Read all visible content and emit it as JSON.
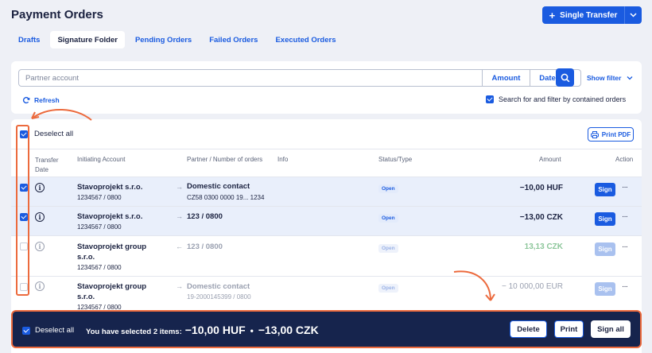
{
  "page_title": "Payment Orders",
  "single_transfer": {
    "plus": "+",
    "label": "Single Transfer",
    "caret": "⌄"
  },
  "tabs": [
    {
      "label": "Drafts"
    },
    {
      "label": "Signature Folder"
    },
    {
      "label": "Pending Orders"
    },
    {
      "label": "Failed Orders"
    },
    {
      "label": "Executed Orders"
    }
  ],
  "filter": {
    "search_placeholder": "Partner account",
    "amount_label": "Amount",
    "date_label": "Date",
    "show_filter": "Show filter",
    "refresh": "Refresh",
    "contained_label": "Search for and filter by contained orders"
  },
  "table": {
    "deselect_all": "Deselect all",
    "print_pdf": "Print PDF",
    "columns": {
      "transfer_date": "Transfer Date",
      "initiating_account": "Initiating Account",
      "partner": "Partner / Number of orders",
      "info": "Info",
      "status": "Status/Type",
      "amount": "Amount",
      "action": "Action"
    },
    "rows": [
      {
        "account": "Stavoprojekt s.r.o.",
        "account_number": "1234567 / 0800",
        "partner": "Domestic contact",
        "partner_number": "CZ58 0300 0000 19... 1234",
        "status": "Open",
        "amount": "−10,00 HUF",
        "sign": "Sign",
        "more": "···"
      },
      {
        "account": "Stavoprojekt s.r.o.",
        "account_number": "1234567 / 0800",
        "partner": "123 / 0800",
        "partner_number": "",
        "status": "Open",
        "amount": "−13,00 CZK",
        "sign": "Sign",
        "more": "···"
      },
      {
        "account": "Stavoprojekt group s.r.o.",
        "account_number": "1234567 / 0800",
        "partner": "123 / 0800",
        "partner_number": "",
        "status": "Open",
        "amount": "13,13 CZK",
        "sign": "Sign",
        "more": "···"
      },
      {
        "account": "Stavoprojekt group s.r.o.",
        "account_number": "1234567 / 0800",
        "partner": "Domestic contact",
        "partner_number": "19-2000145399 / 0800",
        "status": "Open",
        "amount": "− 10 000,00 EUR",
        "sign": "Sign",
        "more": "···"
      }
    ]
  },
  "bottom_bar": {
    "deselect_all": "Deselect all",
    "selected_text": "You have selected 2 items:",
    "total_1": "−10,00 HUF",
    "separator": "•",
    "total_2": "−13,00 CZK",
    "delete": "Delete",
    "print": "Print",
    "sign_all": "Sign all"
  },
  "colors": {
    "primary": "#1a5be0",
    "navy": "#16244d",
    "annotation": "#ec6a3d",
    "positive": "#8cc69a"
  },
  "icons": {
    "info": "i",
    "arrow_out": "→",
    "arrow_in": "←"
  }
}
